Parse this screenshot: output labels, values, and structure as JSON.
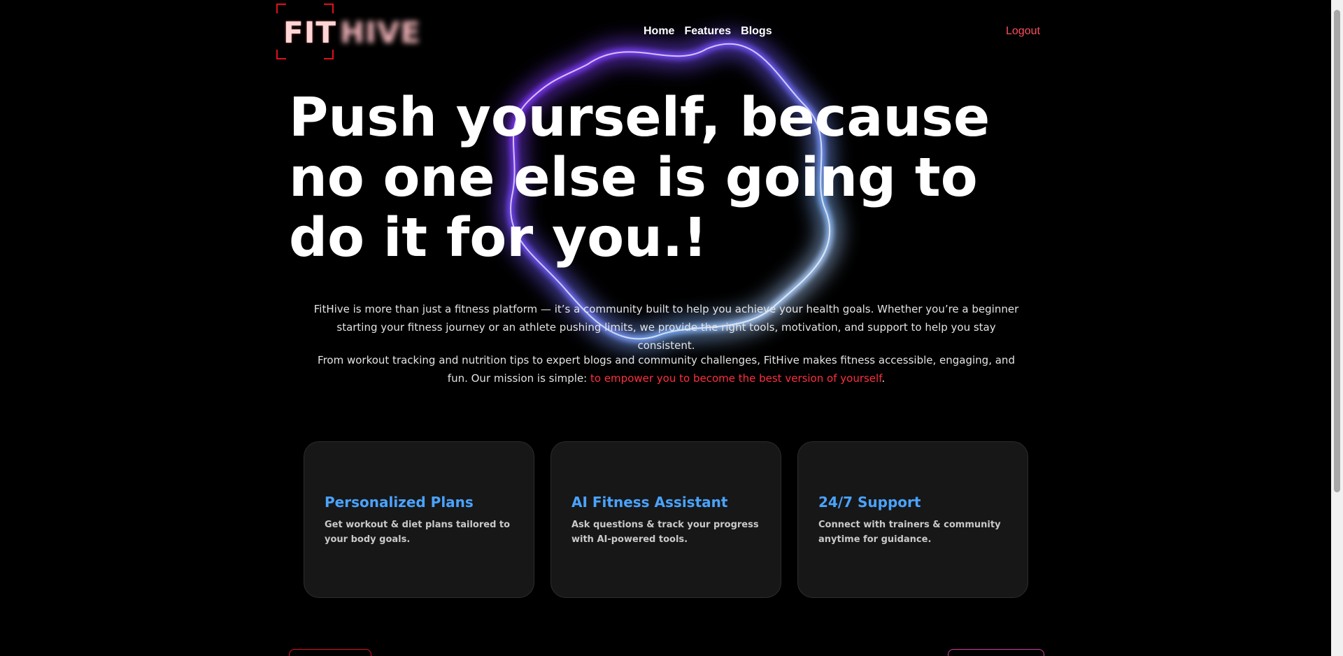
{
  "header": {
    "logo_fit": "FIT",
    "logo_hive": "HIVE",
    "nav": [
      "Home",
      "Features",
      "Blogs"
    ],
    "logout": "Logout"
  },
  "hero": {
    "title": "Push yourself, because no one else is going to do it for you.!",
    "para1": "FitHive is more than just a fitness platform — it’s a community built to help you achieve your health goals. Whether you’re a beginner starting your fitness journey or an athlete pushing limits, we provide the right tools, motivation, and support to help you stay consistent.",
    "para2_prefix": "From workout tracking and nutrition tips to expert blogs and community challenges, FitHive makes fitness accessible, engaging, and fun. Our mission is simple: ",
    "para2_highlight": "to empower you to become the best version of yourself",
    "para2_suffix": "."
  },
  "features": [
    {
      "title": "Personalized Plans",
      "text": "Get workout & diet plans tailored to your body goals."
    },
    {
      "title": "AI Fitness Assistant",
      "text": "Ask questions & track your progress with AI-powered tools."
    },
    {
      "title": "24/7 Support",
      "text": "Connect with trainers & community anytime for guidance."
    }
  ],
  "colors": {
    "accent_red": "#ff2e3f",
    "feature_title_blue": "#4aa3ff",
    "card_bg": "#171717",
    "page_bg": "#000000"
  }
}
